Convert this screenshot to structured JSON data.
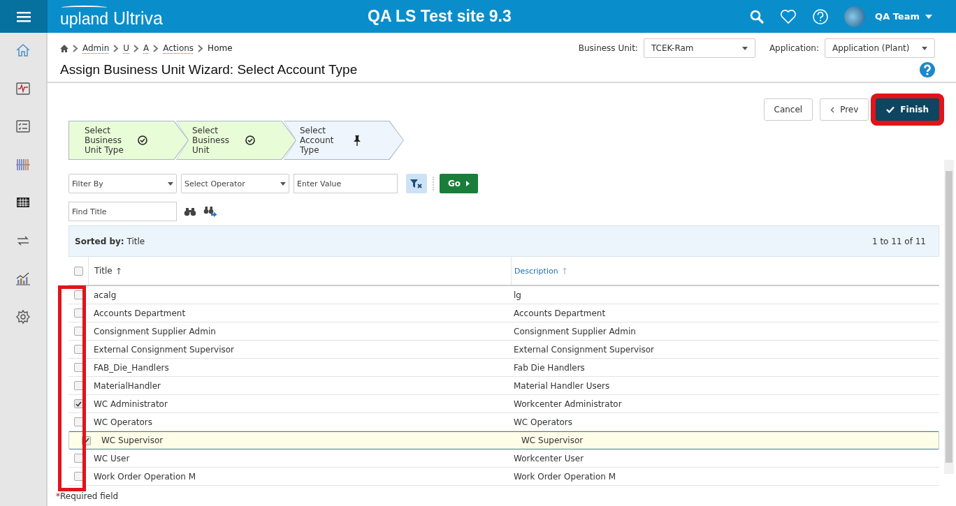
{
  "header": {
    "app_name_prefix": "upland",
    "app_name": "Ultriva",
    "site_title": "QA LS Test site 9.3",
    "user": "QA Team"
  },
  "breadcrumb": [
    {
      "label": "Admin",
      "link": true
    },
    {
      "label": "U",
      "link": true
    },
    {
      "label": "A",
      "link": true
    },
    {
      "label": "Actions",
      "link": true
    },
    {
      "label": "Home",
      "link": false
    }
  ],
  "page_title": "Assign Business Unit Wizard: Select Account Type",
  "business_unit": {
    "label": "Business Unit:",
    "value": "TCEK-Ram"
  },
  "application": {
    "label": "Application:",
    "value": "Application (Plant)"
  },
  "actions": [
    {
      "label": "Cancel",
      "kind": "plain",
      "highlighted": false
    },
    {
      "label": "Prev",
      "kind": "prev",
      "highlighted": false
    },
    {
      "label": "Finish",
      "kind": "primary",
      "highlighted": true
    }
  ],
  "wizard_steps": [
    {
      "label": "Select Business Unit Type",
      "kind": "done"
    },
    {
      "label": "Select Business Unit",
      "kind": "done"
    },
    {
      "label": "Select Account Type",
      "kind": "current"
    }
  ],
  "filter": {
    "filter_by": "Filter By",
    "operator": "Select Operator",
    "value_placeholder": "Enter Value",
    "go": "Go"
  },
  "find": {
    "placeholder": "Find Title"
  },
  "table": {
    "sorted_by_label": "Sorted by:",
    "sorted_by": "Title",
    "range": "1 to 11 of 11",
    "checkbox_column_highlighted": true,
    "all_checked": false,
    "columns": [
      {
        "label": "Title",
        "sorted": true
      },
      {
        "label": "Description",
        "sorted": false
      }
    ],
    "rows": [
      {
        "title": "acalg",
        "description": "lg",
        "checked": false,
        "selected": false
      },
      {
        "title": "Accounts Department",
        "description": "Accounts Department",
        "checked": false,
        "selected": false
      },
      {
        "title": "Consignment Supplier Admin",
        "description": "Consignment Supplier Admin",
        "checked": false,
        "selected": false
      },
      {
        "title": "External Consignment Supervisor",
        "description": "External Consignment Supervisor",
        "checked": false,
        "selected": false
      },
      {
        "title": "FAB_Die_Handlers",
        "description": "Fab Die Handlers",
        "checked": false,
        "selected": false
      },
      {
        "title": "MaterialHandler",
        "description": "Material Handler Users",
        "checked": false,
        "selected": false
      },
      {
        "title": "WC Administrator",
        "description": "Workcenter Administrator",
        "checked": true,
        "selected": false
      },
      {
        "title": "WC Operators",
        "description": "WC Operators",
        "checked": false,
        "selected": false
      },
      {
        "title": "WC Supervisor",
        "description": "WC Supervisor",
        "checked": true,
        "selected": true
      },
      {
        "title": "WC User",
        "description": "Workcenter User",
        "checked": false,
        "selected": false
      },
      {
        "title": "Work Order Operation M",
        "description": "Work Order Operation M",
        "checked": false,
        "selected": false
      }
    ]
  },
  "required_mark": "*",
  "required_note": "Required field"
}
